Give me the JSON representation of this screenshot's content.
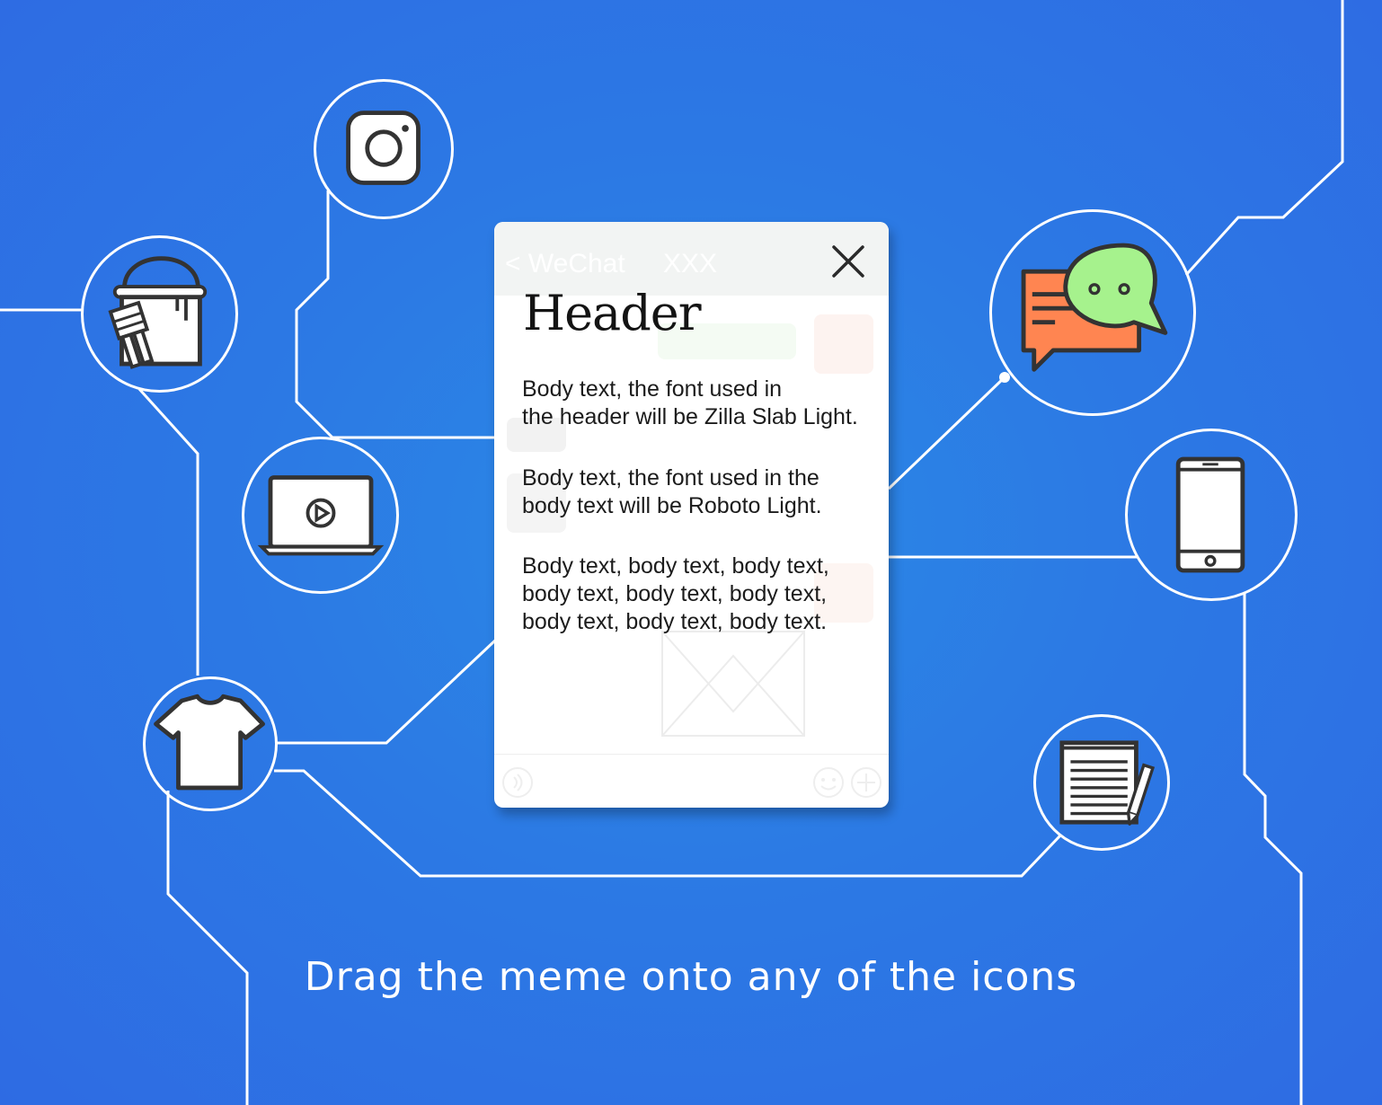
{
  "dialog": {
    "chat_back": "< WeChat",
    "chat_title": "XXX",
    "header": "Header",
    "paragraphs": [
      [
        "Body text, the font used in",
        "the header will be Zilla Slab Light."
      ],
      [
        "Body text, the font used in the",
        "body text will be Roboto Light."
      ],
      [
        "Body text, body text, body text,",
        "body text, body text, body text,",
        "body text, body text, body text."
      ]
    ]
  },
  "caption": "Drag the meme onto any of the icons",
  "icons": [
    "instagram-icon",
    "paint-bucket-icon",
    "laptop-video-icon",
    "tshirt-icon",
    "chat-bubbles-icon",
    "smartphone-icon",
    "notepad-icon",
    "close-icon"
  ],
  "colors": {
    "background": "#2c79e4",
    "line": "#ffffff",
    "icon_outline": "#333333",
    "chat_orange": "#ff8551",
    "chat_green": "#a6f28d"
  }
}
